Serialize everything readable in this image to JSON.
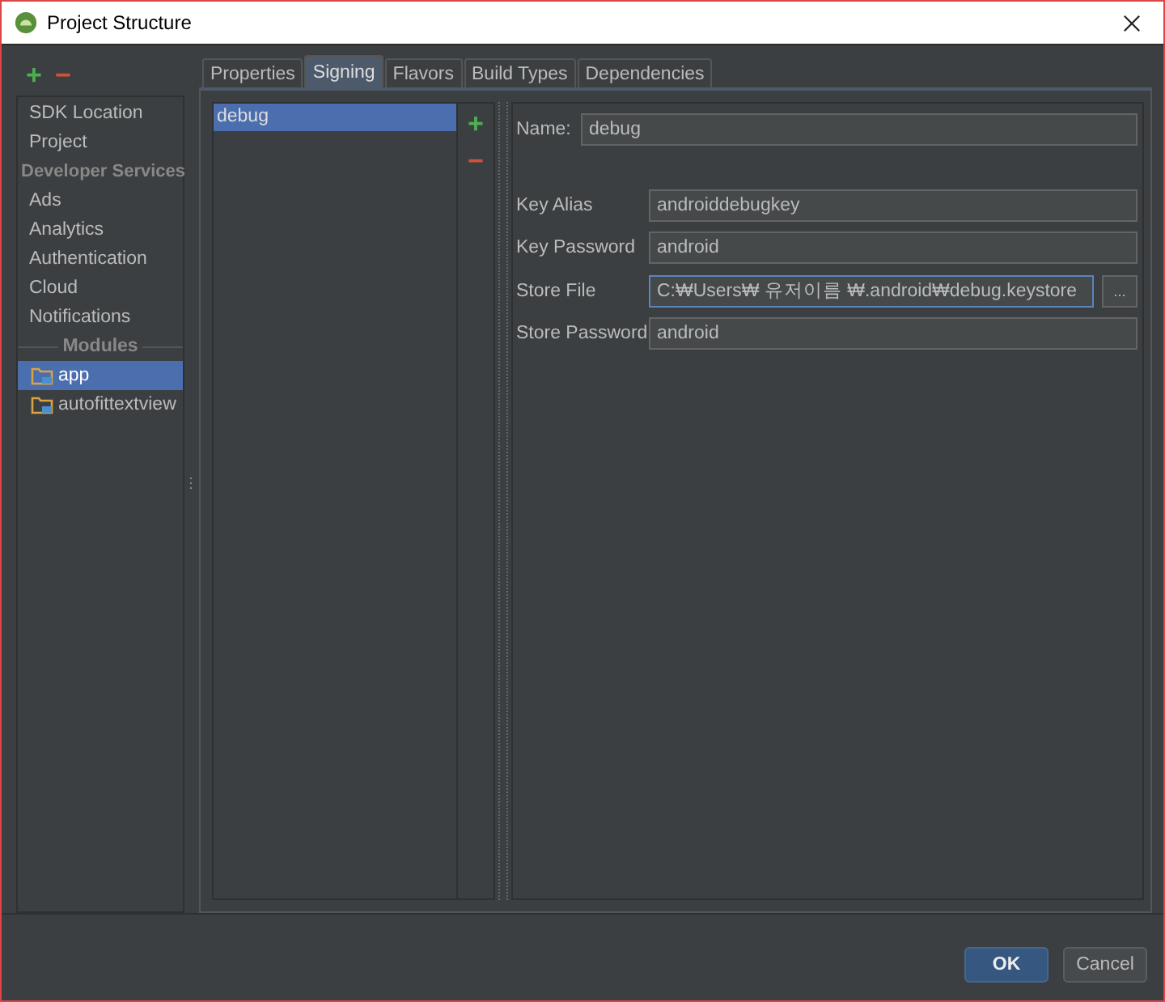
{
  "window": {
    "title": "Project Structure"
  },
  "sidebar": {
    "add": "+",
    "remove": "−",
    "items": [
      {
        "label": "SDK Location",
        "kind": "item",
        "selected": false
      },
      {
        "label": "Project",
        "kind": "item",
        "selected": false
      },
      {
        "label": "Developer Services",
        "kind": "header"
      },
      {
        "label": "Ads",
        "kind": "item",
        "selected": false
      },
      {
        "label": "Analytics",
        "kind": "item",
        "selected": false
      },
      {
        "label": "Authentication",
        "kind": "item",
        "selected": false
      },
      {
        "label": "Cloud",
        "kind": "item",
        "selected": false
      },
      {
        "label": "Notifications",
        "kind": "item",
        "selected": false
      },
      {
        "label": "Modules",
        "kind": "separator"
      },
      {
        "label": "app",
        "kind": "module",
        "selected": true
      },
      {
        "label": "autofittextview",
        "kind": "module",
        "selected": false
      }
    ]
  },
  "tabs": [
    {
      "label": "Properties",
      "selected": false
    },
    {
      "label": "Signing",
      "selected": true
    },
    {
      "label": "Flavors",
      "selected": false
    },
    {
      "label": "Build Types",
      "selected": false
    },
    {
      "label": "Dependencies",
      "selected": false
    }
  ],
  "configs": {
    "add": "+",
    "remove": "−",
    "items": [
      {
        "label": "debug",
        "selected": true
      }
    ]
  },
  "form": {
    "name_label": "Name:",
    "name_value": "debug",
    "fields": [
      {
        "label": "Key Alias",
        "value": "androiddebugkey",
        "focused": false,
        "browse": false
      },
      {
        "label": "Key Password",
        "value": "android",
        "focused": false,
        "browse": false
      },
      {
        "label": "Store File",
        "value": "C:₩Users₩ 유저이름 ₩.android₩debug.keystore",
        "focused": true,
        "browse": true
      },
      {
        "label": "Store Password",
        "value": "android",
        "focused": false,
        "browse": false
      }
    ],
    "browse_label": "..."
  },
  "buttons": [
    "OK",
    "Cancel"
  ]
}
